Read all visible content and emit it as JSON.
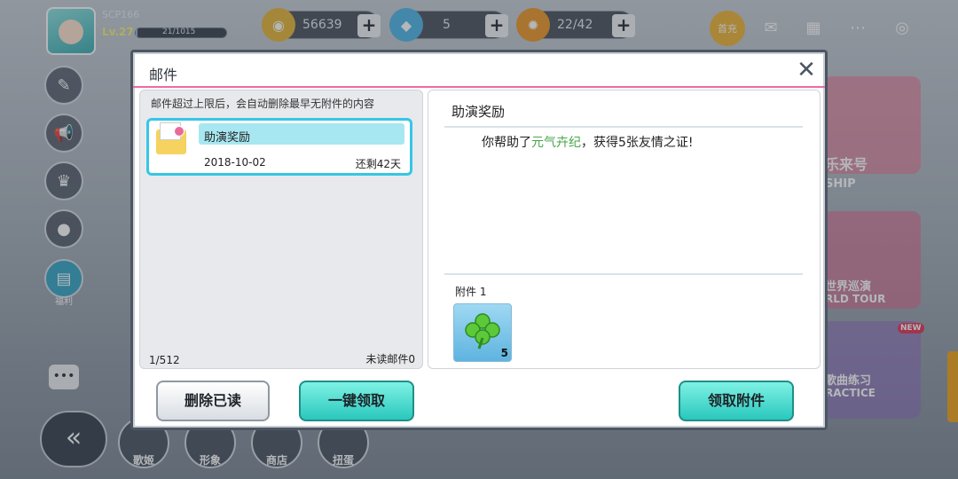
{
  "player": {
    "name": "SCP166",
    "level": "Lv.27",
    "exp_text": "21/1015",
    "exp_fraction": 0.02
  },
  "resources": [
    {
      "name": "coin",
      "icon": "coin-icon",
      "value": "56639"
    },
    {
      "name": "diamond",
      "icon": "diamond-icon",
      "value": "5"
    },
    {
      "name": "energy",
      "icon": "sun-icon",
      "value": "22/42"
    }
  ],
  "top_icons": [
    {
      "name": "first-charge-icon",
      "label": "首充"
    },
    {
      "name": "mail-icon"
    },
    {
      "name": "calendar-icon"
    },
    {
      "name": "more-icon"
    },
    {
      "name": "wifi-icon"
    }
  ],
  "sidebar": {
    "active_label": "福利"
  },
  "right_menu": [
    {
      "label": "乐来号"
    },
    {
      "label": "SHIP"
    },
    {
      "label": "世界巡演"
    },
    {
      "label": "RLD TOUR"
    },
    {
      "label": "NEW"
    },
    {
      "label": "歌曲练习"
    },
    {
      "label": "RACTICE"
    }
  ],
  "bottom_nav": [
    {
      "label": "歌姬"
    },
    {
      "label": "形象"
    },
    {
      "label": "商店"
    },
    {
      "label": "扭蛋"
    }
  ],
  "mail": {
    "title": "邮件",
    "close_symbol": "✕",
    "notice": "邮件超过上限后，会自动删除最早无附件的内容",
    "items": [
      {
        "subject": "助演奖励",
        "date": "2018-10-02",
        "remaining": "还剩42天",
        "selected": true
      }
    ],
    "page": "1/512",
    "unread": "未读邮件0",
    "detail": {
      "title": "助演奖励",
      "body_prefix": "你帮助了",
      "body_highlight": "元气卉纪",
      "body_suffix": "，获得5张友情之证!",
      "attachment_label": "附件  1",
      "attachment_item": "clover-icon",
      "attachment_count": "5"
    },
    "buttons": {
      "delete_read": "删除已读",
      "claim_all": "一键领取",
      "claim_attachment": "领取附件"
    }
  },
  "colors": {
    "accent_teal": "#2ac8bd",
    "selected_border": "#36c6e6",
    "highlight_green": "#48a64a",
    "header_pink": "#ef6aa5"
  }
}
